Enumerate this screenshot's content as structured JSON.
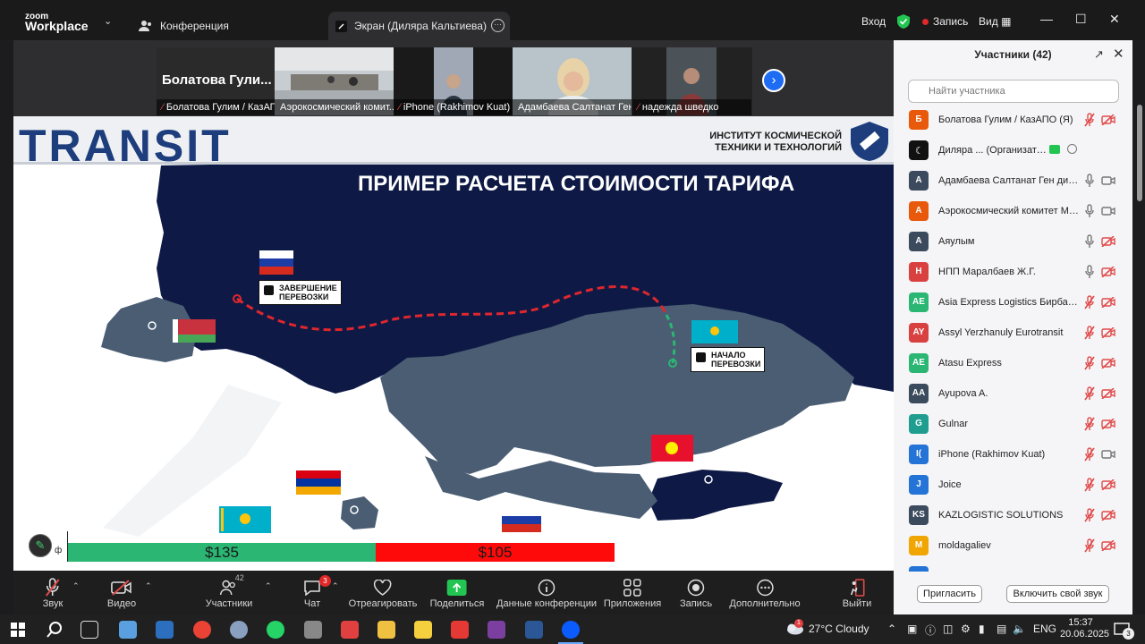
{
  "titlebar": {
    "logo_line1": "zoom",
    "logo_line2": "Workplace",
    "tab_conference": "Конференция",
    "tab_screen": "Экран (Диляра Кальтиева)",
    "sign_in": "Вход",
    "record": "Запись",
    "view": "Вид"
  },
  "video_strip": {
    "tiles": [
      {
        "big": "Болатова Гули...",
        "name": "Болатова Гулим / КазАПО"
      },
      {
        "name": "Аэрокосмический комит..."
      },
      {
        "name": "iPhone (Rakhimov Kuat)"
      },
      {
        "name": "Адамбаева Салтанат Ген..."
      },
      {
        "name": "надежда шведко"
      }
    ]
  },
  "slide": {
    "brand": "TRANSIT",
    "institute_line1": "ИНСТИТУТ КОСМИЧЕСКОЙ",
    "institute_line2": "ТЕХНИКИ И ТЕХНОЛОГИЙ",
    "title": "ПРИМЕР РАСЧЕТА СТОИМОСТИ ТАРИФА",
    "end_label_1": "ЗАВЕРШЕНИЕ",
    "end_label_2": "ПЕРЕВОЗКИ",
    "start_label_1": "НАЧАЛО",
    "start_label_2": "ПЕРЕВОЗКИ",
    "price_kz": "$135",
    "price_ru": "$105",
    "corner_label": "ф"
  },
  "toolbar": {
    "audio": "Звук",
    "video": "Видео",
    "participants": "Участники",
    "participants_count": "42",
    "chat": "Чат",
    "chat_badge": "3",
    "react": "Отреагировать",
    "share": "Поделиться",
    "info": "Данные конференции",
    "apps": "Приложения",
    "record": "Запись",
    "more": "Дополнительно",
    "leave": "Выйти"
  },
  "participants_panel": {
    "title": "Участники (42)",
    "search_placeholder": "Найти участника",
    "participants": [
      {
        "initials": "Б",
        "name": "Болатова Гулим / КазАПО (Я)",
        "color": "#e8590c",
        "mic": "muted",
        "cam": "off"
      },
      {
        "initials": "",
        "name": "Диляра ... (Организатор)",
        "color": "#111111",
        "mic": "none",
        "cam": "none"
      },
      {
        "initials": "A",
        "name": "Адамбаева Салтанат Ген дир Ка...",
        "color": "#3b4a5c",
        "mic": "on",
        "cam": "on"
      },
      {
        "initials": "A",
        "name": "Аэрокосмический комитет МЦ...",
        "color": "#e8590c",
        "mic": "on",
        "cam": "on"
      },
      {
        "initials": "A",
        "name": "Аяулым",
        "color": "#3b4a5c",
        "mic": "on",
        "cam": "off"
      },
      {
        "initials": "Н",
        "name": "НПП Маралбаев Ж.Г.",
        "color": "#d94040",
        "mic": "on",
        "cam": "off"
      },
      {
        "initials": "AE",
        "name": "Asia Express Logistics Бирбаев Б...",
        "color": "#2bb673",
        "mic": "muted",
        "cam": "off"
      },
      {
        "initials": "AY",
        "name": "Assyl Yerzhanuly Eurotransit",
        "color": "#d94040",
        "mic": "muted",
        "cam": "off"
      },
      {
        "initials": "AE",
        "name": "Atasu Express",
        "color": "#2bb673",
        "mic": "muted",
        "cam": "off"
      },
      {
        "initials": "AA",
        "name": "Ayupova A.",
        "color": "#3b4a5c",
        "mic": "muted",
        "cam": "off"
      },
      {
        "initials": "G",
        "name": "Gulnar",
        "color": "#1f9e8f",
        "mic": "muted",
        "cam": "off"
      },
      {
        "initials": "I(",
        "name": "iPhone (Rakhimov Kuat)",
        "color": "#2473d6",
        "mic": "muted",
        "cam": "on"
      },
      {
        "initials": "J",
        "name": "Joice",
        "color": "#2473d6",
        "mic": "muted",
        "cam": "off"
      },
      {
        "initials": "KS",
        "name": "KAZLOGISTIC SOLUTIONS",
        "color": "#3b4a5c",
        "mic": "muted",
        "cam": "off"
      },
      {
        "initials": "M",
        "name": "moldagaliev",
        "color": "#f0a500",
        "mic": "muted",
        "cam": "off"
      }
    ],
    "invite": "Пригласить",
    "unmute": "Включить свой звук"
  },
  "taskbar": {
    "weather_badge": "1",
    "weather": "27°C  Cloudy",
    "lang": "ENG",
    "time": "15:37",
    "date": "20.06.2025",
    "notif": "3"
  }
}
